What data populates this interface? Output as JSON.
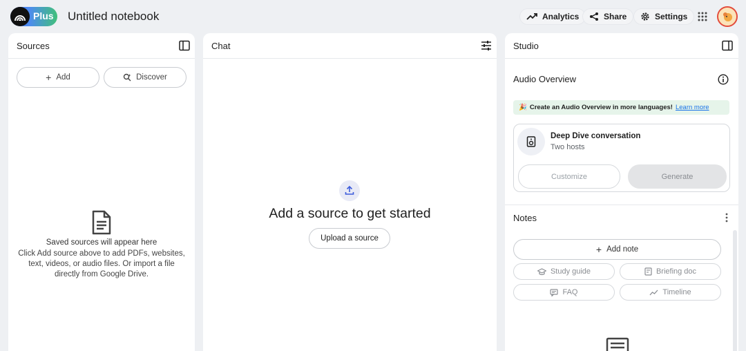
{
  "app": {
    "logo_text": "Plus",
    "notebook_title": "Untitled notebook",
    "avatar_alt": "user avatar"
  },
  "header": {
    "analytics_label": "Analytics",
    "share_label": "Share",
    "settings_label": "Settings"
  },
  "sources": {
    "title": "Sources",
    "add_label": "Add",
    "discover_label": "Discover",
    "empty_title": "Saved sources will appear here",
    "empty_body": "Click Add source above to add PDFs, websites, text, videos, or audio files. Or import a file directly from Google Drive."
  },
  "chat": {
    "title": "Chat",
    "heading": "Add a source to get started",
    "upload_label": "Upload a source"
  },
  "studio": {
    "title": "Studio",
    "audio_title": "Audio Overview",
    "banner_emoji": "🎉",
    "banner_text": "Create an Audio Overview in more languages!",
    "banner_link": "Learn more",
    "deep_dive_title": "Deep Dive conversation",
    "deep_dive_sub": "Two hosts",
    "customize_label": "Customize",
    "generate_label": "Generate",
    "notes_title": "Notes",
    "add_note_label": "Add note",
    "study_guide_label": "Study guide",
    "briefing_doc_label": "Briefing doc",
    "faq_label": "FAQ",
    "timeline_label": "Timeline"
  },
  "colors": {
    "accent": "#1a73e8",
    "banner_bg": "#e6f4ea",
    "page_bg": "#eef0f3"
  }
}
